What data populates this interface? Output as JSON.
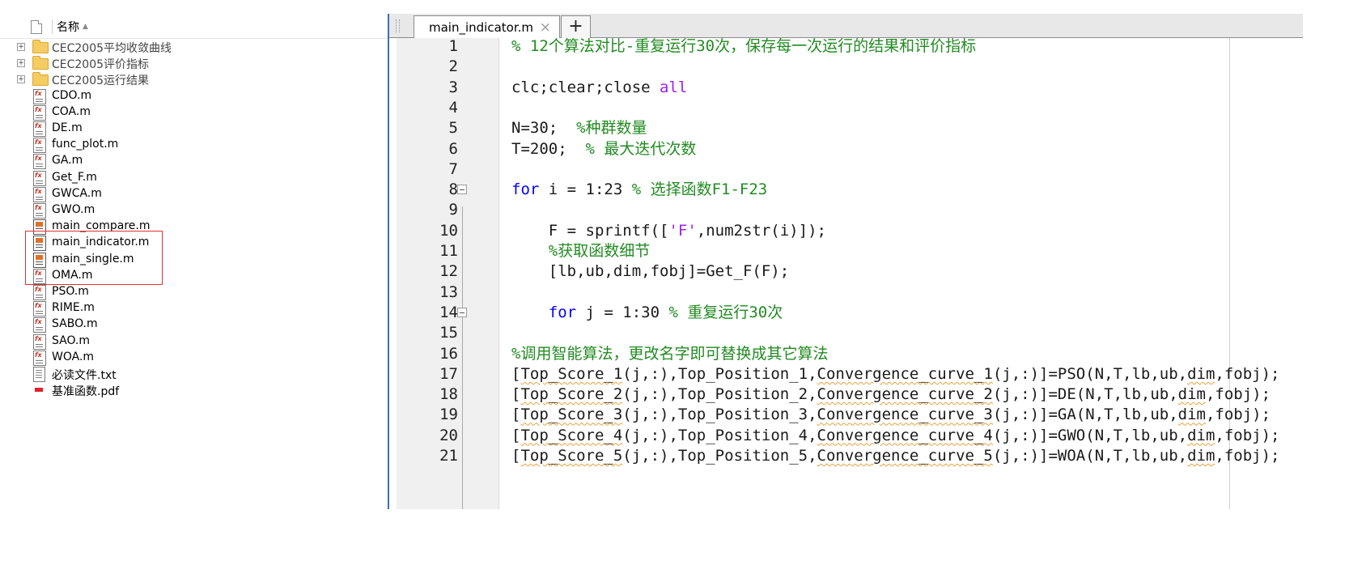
{
  "file_browser": {
    "header": {
      "column_label": "名称",
      "sort_indicator": "▲"
    },
    "items": [
      {
        "name": "CEC2005平均收敛曲线",
        "type": "folder",
        "expander": "+"
      },
      {
        "name": "CEC2005评价指标",
        "type": "folder",
        "expander": "+"
      },
      {
        "name": "CEC2005运行结果",
        "type": "folder",
        "expander": "+"
      },
      {
        "name": "CDO.m",
        "type": "function"
      },
      {
        "name": "COA.m",
        "type": "function"
      },
      {
        "name": "DE.m",
        "type": "function"
      },
      {
        "name": "func_plot.m",
        "type": "function"
      },
      {
        "name": "GA.m",
        "type": "function"
      },
      {
        "name": "Get_F.m",
        "type": "function"
      },
      {
        "name": "GWCA.m",
        "type": "function"
      },
      {
        "name": "GWO.m",
        "type": "function"
      },
      {
        "name": "main_compare.m",
        "type": "script"
      },
      {
        "name": "main_indicator.m",
        "type": "script"
      },
      {
        "name": "main_single.m",
        "type": "script"
      },
      {
        "name": "OMA.m",
        "type": "function"
      },
      {
        "name": "PSO.m",
        "type": "function"
      },
      {
        "name": "RIME.m",
        "type": "function"
      },
      {
        "name": "SABO.m",
        "type": "function"
      },
      {
        "name": "SAO.m",
        "type": "function"
      },
      {
        "name": "WOA.m",
        "type": "function"
      },
      {
        "name": "必读文件.txt",
        "type": "text"
      },
      {
        "name": "基准函数.pdf",
        "type": "pdf"
      }
    ],
    "highlight_color": "#e03030"
  },
  "editor": {
    "active_tab": "main_indicator.m",
    "close_glyph": "×",
    "add_tab_glyph": "+",
    "colors": {
      "comment": "#228b22",
      "keyword": "#0000ff",
      "string": "#a020f0"
    },
    "lines": [
      {
        "num": "1",
        "segments": [
          {
            "t": "% 12个算法对比-重复运行30次，保存每一次运行的结果和评价指标",
            "c": "comment"
          }
        ]
      },
      {
        "num": "2",
        "segments": []
      },
      {
        "num": "3",
        "segments": [
          {
            "t": "clc;clear;close ",
            "c": "text"
          },
          {
            "t": "all",
            "c": "string"
          }
        ]
      },
      {
        "num": "4",
        "segments": []
      },
      {
        "num": "5",
        "segments": [
          {
            "t": "N=30;  ",
            "c": "text"
          },
          {
            "t": "%种群数量",
            "c": "comment"
          }
        ]
      },
      {
        "num": "6",
        "segments": [
          {
            "t": "T=200;  ",
            "c": "text"
          },
          {
            "t": "% 最大迭代次数",
            "c": "comment"
          }
        ]
      },
      {
        "num": "7",
        "segments": []
      },
      {
        "num": "8",
        "fold": true,
        "segments": [
          {
            "t": "for",
            "c": "keyword"
          },
          {
            "t": " i = 1:23 ",
            "c": "text"
          },
          {
            "t": "% 选择函数F1-F23",
            "c": "comment"
          }
        ]
      },
      {
        "num": "9",
        "segments": []
      },
      {
        "num": "10",
        "segments": [
          {
            "t": "    F = sprintf([",
            "c": "text"
          },
          {
            "t": "'F'",
            "c": "string"
          },
          {
            "t": ",num2str(i)]);",
            "c": "text"
          }
        ]
      },
      {
        "num": "11",
        "segments": [
          {
            "t": "    %获取函数细节",
            "c": "comment"
          }
        ]
      },
      {
        "num": "12",
        "segments": [
          {
            "t": "    [lb,ub,dim,fobj]=Get_F(F);",
            "c": "text"
          }
        ]
      },
      {
        "num": "13",
        "segments": []
      },
      {
        "num": "14",
        "fold": true,
        "segments": [
          {
            "t": "    ",
            "c": "text"
          },
          {
            "t": "for",
            "c": "keyword"
          },
          {
            "t": " j = 1:30 ",
            "c": "text"
          },
          {
            "t": "% 重复运行30次",
            "c": "comment"
          }
        ]
      },
      {
        "num": "15",
        "segments": []
      },
      {
        "num": "16",
        "segments": [
          {
            "t": "%调用智能算法，更改名字即可替换成其它算法",
            "c": "comment"
          }
        ]
      },
      {
        "num": "17",
        "segments": [
          {
            "t": "[",
            "c": "text"
          },
          {
            "t": "Top_Score_1",
            "c": "text",
            "u": true
          },
          {
            "t": "(j,:),Top_Position_1,",
            "c": "text"
          },
          {
            "t": "Convergence_curve_1",
            "c": "text",
            "u": true
          },
          {
            "t": "(j,:)]=PSO(N,T,lb,ub,",
            "c": "text"
          },
          {
            "t": "dim",
            "c": "text",
            "u": true
          },
          {
            "t": ",fobj);",
            "c": "text"
          }
        ]
      },
      {
        "num": "18",
        "segments": [
          {
            "t": "[",
            "c": "text"
          },
          {
            "t": "Top_Score_2",
            "c": "text",
            "u": true
          },
          {
            "t": "(j,:),Top_Position_2,",
            "c": "text"
          },
          {
            "t": "Convergence_curve_2",
            "c": "text",
            "u": true
          },
          {
            "t": "(j,:)]=DE(N,T,lb,ub,",
            "c": "text"
          },
          {
            "t": "dim",
            "c": "text",
            "u": true
          },
          {
            "t": ",fobj);",
            "c": "text"
          }
        ]
      },
      {
        "num": "19",
        "segments": [
          {
            "t": "[",
            "c": "text"
          },
          {
            "t": "Top_Score_3",
            "c": "text",
            "u": true
          },
          {
            "t": "(j,:),Top_Position_3,",
            "c": "text"
          },
          {
            "t": "Convergence_curve_3",
            "c": "text",
            "u": true
          },
          {
            "t": "(j,:)]=GA(N,T,lb,ub,",
            "c": "text"
          },
          {
            "t": "dim",
            "c": "text",
            "u": true
          },
          {
            "t": ",fobj);",
            "c": "text"
          }
        ]
      },
      {
        "num": "20",
        "segments": [
          {
            "t": "[",
            "c": "text"
          },
          {
            "t": "Top_Score_4",
            "c": "text",
            "u": true
          },
          {
            "t": "(j,:),Top_Position_4,",
            "c": "text"
          },
          {
            "t": "Convergence_curve_4",
            "c": "text",
            "u": true
          },
          {
            "t": "(j,:)]=GWO(N,T,lb,ub,",
            "c": "text"
          },
          {
            "t": "dim",
            "c": "text",
            "u": true
          },
          {
            "t": ",fobj);",
            "c": "text"
          }
        ]
      },
      {
        "num": "21",
        "segments": [
          {
            "t": "[",
            "c": "text"
          },
          {
            "t": "Top_Score_5",
            "c": "text",
            "u": true
          },
          {
            "t": "(j,:),Top_Position_5,",
            "c": "text"
          },
          {
            "t": "Convergence_curve_5",
            "c": "text",
            "u": true
          },
          {
            "t": "(j,:)]=WOA(N,T,lb,ub,",
            "c": "text"
          },
          {
            "t": "dim",
            "c": "text",
            "u": true
          },
          {
            "t": ",fobj);",
            "c": "text"
          }
        ]
      }
    ]
  }
}
